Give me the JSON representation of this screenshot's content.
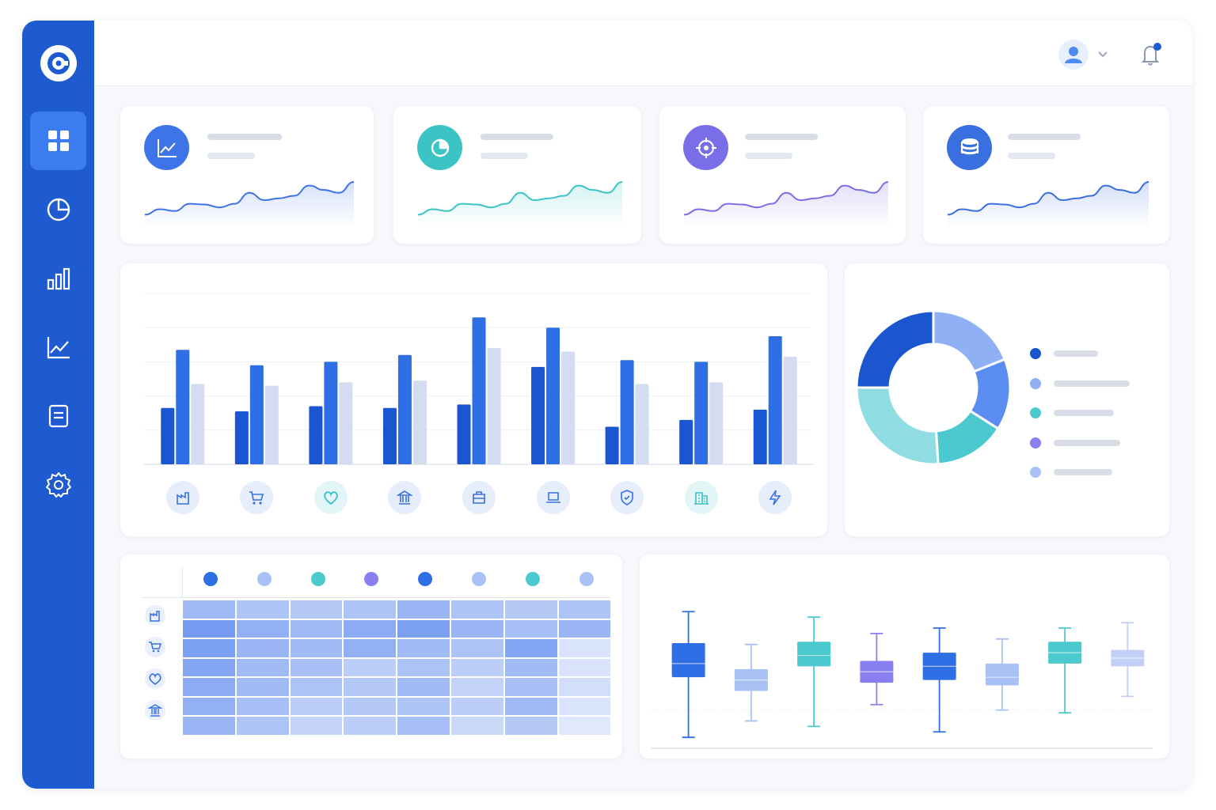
{
  "colors": {
    "sidebar": "#1f5bd0",
    "sidebar_active": "#3b7cf0",
    "primary": "#2f6fe6",
    "mid": "#5b8df0",
    "light": "#a9c1f5",
    "pale": "#d3dcf1",
    "teal": "#4cc9cf",
    "teal_light": "#8fdde3",
    "purple": "#8a7ff0",
    "dark_blue": "#1a56cf"
  },
  "sidebar": {
    "logo_icon": "logo-icon",
    "items": [
      {
        "icon": "grid-icon",
        "active": true
      },
      {
        "icon": "pie-chart-icon",
        "active": false
      },
      {
        "icon": "bar-chart-icon",
        "active": false
      },
      {
        "icon": "line-chart-icon",
        "active": false
      },
      {
        "icon": "document-icon",
        "active": false
      },
      {
        "icon": "gear-icon",
        "active": false
      }
    ]
  },
  "topbar": {
    "avatar_icon": "user-icon",
    "dropdown_icon": "chevron-down-icon",
    "notification_icon": "bell-icon",
    "has_notification": true
  },
  "kpi_cards": [
    {
      "icon": "trend-line-icon",
      "color": "#3f74e8",
      "line": [
        0.1,
        0.25,
        0.2,
        0.4,
        0.38,
        0.3,
        0.4,
        0.7,
        0.5,
        0.55,
        0.62,
        0.9,
        0.78,
        0.7,
        1.0
      ],
      "accent": "#3f74e8"
    },
    {
      "icon": "pie-chart-icon",
      "color": "#3cc4c4",
      "line": [
        0.1,
        0.25,
        0.2,
        0.4,
        0.38,
        0.3,
        0.4,
        0.7,
        0.5,
        0.55,
        0.62,
        0.9,
        0.78,
        0.7,
        1.0
      ],
      "accent": "#3cc4c4"
    },
    {
      "icon": "target-icon",
      "color": "#7a6ee8",
      "line": [
        0.1,
        0.25,
        0.2,
        0.4,
        0.38,
        0.3,
        0.4,
        0.7,
        0.5,
        0.55,
        0.62,
        0.9,
        0.78,
        0.7,
        1.0
      ],
      "accent": "#7a6ee8"
    },
    {
      "icon": "database-icon",
      "color": "#3a6fe0",
      "line": [
        0.1,
        0.25,
        0.2,
        0.4,
        0.38,
        0.3,
        0.4,
        0.7,
        0.5,
        0.55,
        0.62,
        0.9,
        0.78,
        0.7,
        1.0
      ],
      "accent": "#3a6fe0"
    }
  ],
  "chart_data": [
    {
      "type": "bar",
      "categories": [
        "factory-icon",
        "cart-icon",
        "heart-icon",
        "bank-icon",
        "briefcase-icon",
        "laptop-icon",
        "shield-icon",
        "building-icon",
        "lightning-icon"
      ],
      "series": [
        {
          "color": "#1a56cf",
          "values": [
            33,
            31,
            34,
            33,
            35,
            57,
            22,
            26,
            32
          ]
        },
        {
          "color": "#2f6fe6",
          "values": [
            67,
            58,
            60,
            64,
            86,
            80,
            61,
            60,
            75
          ]
        },
        {
          "color": "#d3dcf1",
          "values": [
            47,
            46,
            48,
            49,
            68,
            66,
            47,
            48,
            63
          ]
        }
      ],
      "ylim": [
        0,
        100
      ],
      "grid": true
    },
    {
      "type": "pie",
      "donut": true,
      "values": [
        25,
        19,
        15,
        15,
        26
      ],
      "colors": [
        "#1a56cf",
        "#8fb0f5",
        "#5b8df0",
        "#4cc9cf",
        "#8fdde3"
      ],
      "legend_colors": [
        "#1a56cf",
        "#8fb0f5",
        "#4cc9cf",
        "#8a7ff0",
        "#a9c1f5"
      ],
      "legend_placement": "right"
    },
    {
      "type": "heatmap",
      "column_colors": [
        "#2f6fe6",
        "#a9c1f5",
        "#4cc9cf",
        "#8a7ff0",
        "#2f6fe6",
        "#a9c1f5",
        "#4cc9cf",
        "#a9c1f5"
      ],
      "row_icons": [
        "factory-icon",
        "cart-icon",
        "heart-icon",
        "bank-icon"
      ],
      "values": [
        [
          0.55,
          0.45,
          0.4,
          0.45,
          0.6,
          0.45,
          0.4,
          0.45
        ],
        [
          0.85,
          0.65,
          0.55,
          0.7,
          0.8,
          0.6,
          0.5,
          0.6
        ],
        [
          0.8,
          0.6,
          0.55,
          0.65,
          0.55,
          0.45,
          0.75,
          0.15
        ],
        [
          0.75,
          0.55,
          0.5,
          0.35,
          0.45,
          0.35,
          0.55,
          0.15
        ],
        [
          0.7,
          0.55,
          0.45,
          0.4,
          0.55,
          0.3,
          0.5,
          0.2
        ],
        [
          0.65,
          0.5,
          0.35,
          0.4,
          0.45,
          0.35,
          0.55,
          0.15
        ],
        [
          0.6,
          0.45,
          0.3,
          0.35,
          0.5,
          0.25,
          0.4,
          0.1
        ]
      ]
    },
    {
      "type": "box",
      "boxes": [
        {
          "color": "#2f6fe6",
          "min": 8,
          "q1": 52,
          "median": 62,
          "q3": 77,
          "max": 100
        },
        {
          "color": "#a9c1f5",
          "min": 20,
          "q1": 42,
          "median": 50,
          "q3": 58,
          "max": 76
        },
        {
          "color": "#4cc9cf",
          "min": 16,
          "q1": 60,
          "median": 68,
          "q3": 78,
          "max": 96
        },
        {
          "color": "#8a7ff0",
          "min": 32,
          "q1": 48,
          "median": 56,
          "q3": 64,
          "max": 84
        },
        {
          "color": "#2f6fe6",
          "min": 12,
          "q1": 50,
          "median": 60,
          "q3": 70,
          "max": 88
        },
        {
          "color": "#a9c1f5",
          "min": 28,
          "q1": 46,
          "median": 52,
          "q3": 62,
          "max": 80
        },
        {
          "color": "#4cc9cf",
          "min": 26,
          "q1": 62,
          "median": 70,
          "q3": 78,
          "max": 88
        },
        {
          "color": "#c3d0f5",
          "min": 38,
          "q1": 60,
          "median": 66,
          "q3": 72,
          "max": 92
        }
      ],
      "ylim": [
        0,
        110
      ]
    }
  ]
}
